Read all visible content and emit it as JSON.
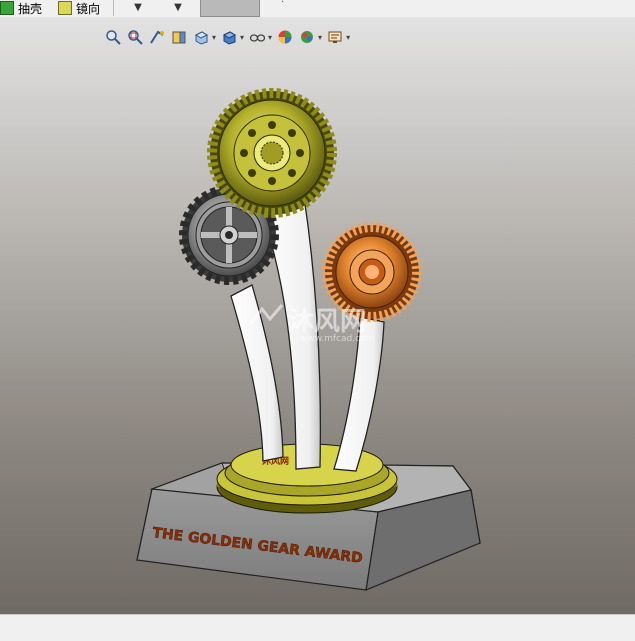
{
  "toolbar": {
    "shell_label": "抽壳",
    "mirror_label": "镜向",
    "dropdown_caret": "▼",
    "small_text": "·"
  },
  "hud": {
    "icons": [
      "zoom-to-fit-icon",
      "zoom-area-icon",
      "previous-view-icon",
      "section-view-icon",
      "view-orientation-icon",
      "display-style-icon",
      "hide-show-items-icon",
      "edit-appearance-icon",
      "apply-scene-icon",
      "view-settings-icon"
    ]
  },
  "trophy": {
    "plaque_text": "THE GOLDEN GEAR AWARD",
    "base_logo_text": "沐风网"
  },
  "watermark": {
    "text": "沐风网",
    "subtext": "www.mfcad.com"
  },
  "colors": {
    "gold": "#c8c43a",
    "gold_dark": "#6a6a12",
    "steel": "#8f8f8f",
    "copper": "#e07d2a",
    "base_gray": "#8d8d8d",
    "plaque_text": "#8a2e05"
  }
}
